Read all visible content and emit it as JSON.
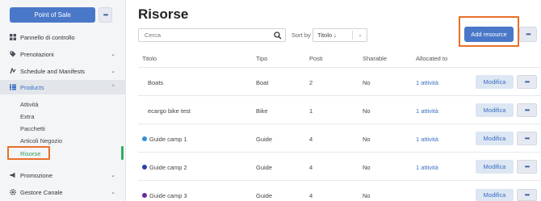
{
  "sidebar": {
    "pos_label": "Point of Sale",
    "pos_more": "•••",
    "items": [
      {
        "label": "Pannello di controllo",
        "icon": "dashboard-grid-icon"
      },
      {
        "label": "Prenotazioni",
        "icon": "tag-icon"
      },
      {
        "label": "Schedule and Manifests",
        "icon": "route-icon"
      },
      {
        "label": "Products",
        "icon": "list-icon"
      },
      {
        "label": "Promozione",
        "icon": "megaphone-icon"
      },
      {
        "label": "Gestore Canale",
        "icon": "gear-icon"
      }
    ],
    "sub_items": [
      "Attività",
      "Extra",
      "Pacchetti",
      "Articoli Negozio",
      "Risorse"
    ]
  },
  "main": {
    "title": "Risorse",
    "search_placeholder": "Cerca",
    "sort_label": "Sort by",
    "sort_value": "Titolo ↓",
    "add_label": "Add resource",
    "more": "•••",
    "columns": [
      "Titolo",
      "Tipo",
      "Posti",
      "Sharable",
      "Allocated to"
    ],
    "edit_label": "Modifica",
    "rows": [
      {
        "title": "Boats",
        "type": "Boat",
        "seats": "2",
        "sharable": "No",
        "allocated": "1 attività",
        "dot": ""
      },
      {
        "title": "ecargo bike test",
        "type": "Bike",
        "seats": "1",
        "sharable": "No",
        "allocated": "1 attività",
        "dot": ""
      },
      {
        "title": "Guide camp 1",
        "type": "Guide",
        "seats": "4",
        "sharable": "No",
        "allocated": "1 attività",
        "dot": "#2f8fdc"
      },
      {
        "title": "Guide camp 2",
        "type": "Guide",
        "seats": "4",
        "sharable": "No",
        "allocated": "1 attività",
        "dot": "#2a3fa8"
      },
      {
        "title": "Guide camp 3",
        "type": "Guide",
        "seats": "4",
        "sharable": "No",
        "allocated": "",
        "dot": "#6a2a9e"
      }
    ]
  },
  "colors": {
    "primary": "#4a78c8",
    "highlight": "#e8702a",
    "active_green": "#2f9e5a"
  }
}
